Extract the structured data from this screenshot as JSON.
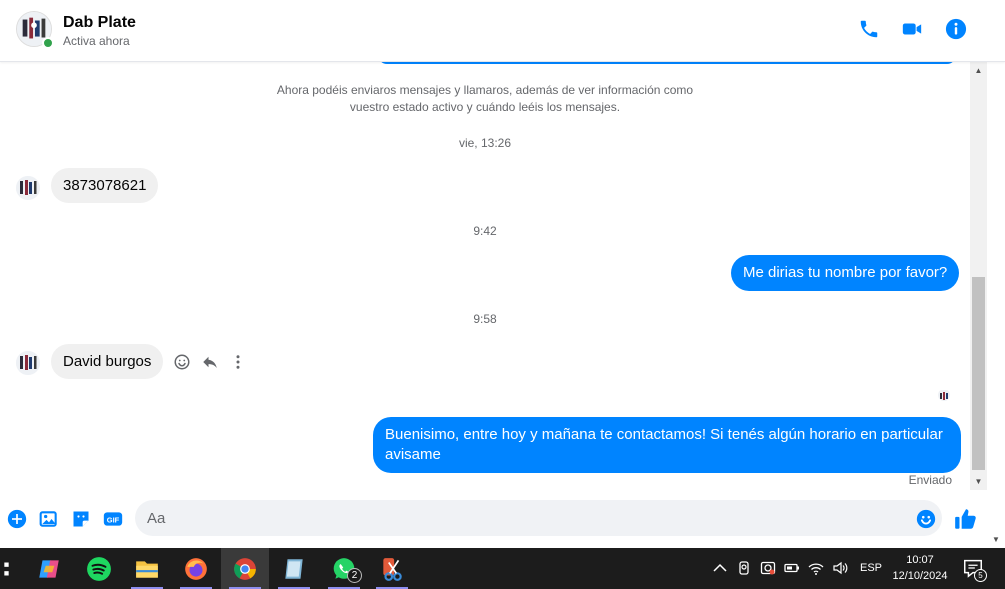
{
  "header": {
    "contact_name": "Dab Plate",
    "status": "Activa ahora"
  },
  "chat": {
    "system_notice": "Ahora podéis enviaros mensajes y llamaros, además de ver información como vuestro estado activo y cuándo leéis los mensajes.",
    "ts1": "vie, 13:26",
    "msg1": "3873078621",
    "ts2": "9:42",
    "msg2": "Me dirias tu nombre por favor?",
    "ts3": "9:58",
    "msg3": "David burgos",
    "msg4": "Buenisimo, entre hoy y mañana te contactamos! Si tenés algún horario en particular avisame",
    "sent_status": "Enviado"
  },
  "composer": {
    "placeholder": "Aa"
  },
  "taskbar": {
    "whatsapp_badge": "2",
    "language": "ESP",
    "time": "10:07",
    "date": "12/10/2024",
    "notifications": "5"
  },
  "colors": {
    "accent": "#0084ff",
    "incoming_bubble": "#f0f0f0",
    "online": "#31a24c",
    "taskbar": "#1c1c1c"
  }
}
